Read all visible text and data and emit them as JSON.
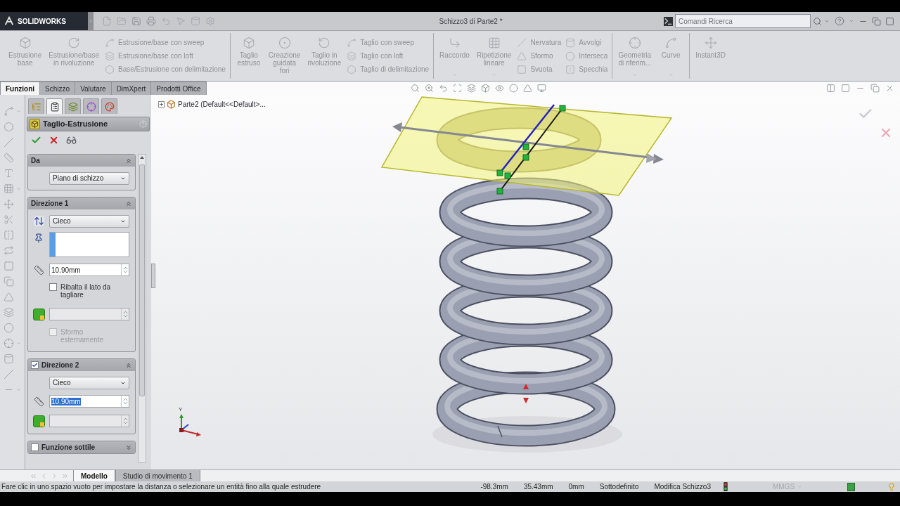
{
  "title_bar": {
    "brand": "SOLIDWORKS",
    "document_title": "Schizzo3 di Parte2 *",
    "search": {
      "placeholder": "Comandi Ricerca"
    }
  },
  "ribbon": {
    "disabled": true,
    "groups": [
      {
        "large": [
          {
            "label": "Estrusione base",
            "menu": false
          },
          {
            "label": "Estrusione/base in rivoluzione",
            "menu": false
          }
        ],
        "columns": [
          [
            "Estrusione/base con sweep",
            "Estrusione/base con loft",
            "Base/Estrusione con delimitazione"
          ]
        ]
      },
      {
        "large": [
          {
            "label": "Taglio estruso",
            "menu": false
          },
          {
            "label": "Creazione guidata fori",
            "menu": false
          },
          {
            "label": "Taglio in rivoluzione",
            "menu": false
          }
        ],
        "columns": [
          [
            "Taglio con sweep",
            "Taglio con loft",
            "Taglio di delimitazione"
          ]
        ]
      },
      {
        "large": [
          {
            "label": "Raccordo",
            "menu": true
          },
          {
            "label": "Ripetizione lineare",
            "menu": true
          }
        ],
        "columns": [
          [
            "Nervatura",
            "Sformo",
            "Svuota"
          ],
          [
            "Avvolgi",
            "Interseca",
            "Specchia"
          ]
        ]
      },
      {
        "large": [
          {
            "label": "Geometria di riferim...",
            "menu": true
          },
          {
            "label": "Curve",
            "menu": true
          }
        ]
      },
      {
        "large": [
          {
            "label": "Instant3D",
            "menu": false
          }
        ]
      }
    ]
  },
  "command_tabs": [
    {
      "label": "Funzioni",
      "selected": true
    },
    {
      "label": "Schizzo",
      "selected": false
    },
    {
      "label": "Valutare",
      "selected": false
    },
    {
      "label": "DimXpert",
      "selected": false
    },
    {
      "label": "Prodotti Office",
      "selected": false
    }
  ],
  "property_manager": {
    "tabs": [
      {
        "selected": false
      },
      {
        "selected": true
      },
      {
        "selected": false
      },
      {
        "selected": false
      },
      {
        "selected": false
      }
    ],
    "title": "Taglio-Estrusione",
    "sections": [
      {
        "title": "Da",
        "kind": "fixed",
        "expanded": true,
        "rows": [
          {
            "kind": "dropdown",
            "value": "Piano di schizzo",
            "reverse_button": false
          }
        ]
      },
      {
        "title": "Direzione 1",
        "kind": "fixed",
        "expanded": true,
        "rows": [
          {
            "kind": "dropdown",
            "value": "Cieco",
            "reverse_button": true
          },
          {
            "kind": "selection",
            "active": true
          },
          {
            "kind": "spinner",
            "value": "10.90mm",
            "selected": false
          },
          {
            "kind": "checkbox",
            "label": "Ribalta il lato da tagliare",
            "checked": false,
            "disabled": false
          },
          {
            "kind": "draft"
          },
          {
            "kind": "checkbox",
            "label": "Sformo esternamente",
            "checked": false,
            "disabled": true
          }
        ]
      },
      {
        "title": "Direzione 2",
        "kind": "optional",
        "checked": true,
        "expanded": true,
        "rows": [
          {
            "kind": "dropdown",
            "value": "Cieco",
            "reverse_button": false
          },
          {
            "kind": "spinner",
            "value": "10.90mm",
            "selected": true
          },
          {
            "kind": "draft"
          }
        ]
      },
      {
        "title": "Funzione sottile",
        "kind": "optional",
        "checked": false,
        "expanded": false
      }
    ]
  },
  "feature_tree": {
    "label": "Parte2 (Default<<Default>...",
    "expanded": false
  },
  "triad": {
    "label": "Y"
  },
  "bottom_tabs": [
    {
      "label": "Modello",
      "selected": true
    },
    {
      "label": "Studio di movimento 1",
      "selected": false
    }
  ],
  "status_bar": {
    "message": "Fare clic in uno spazio vuoto per impostare la distanza o selezionare un entità fino alla quale estrudere",
    "fields": [
      "-98.3mm",
      "35.43mm",
      "0mm",
      "Sottodefinito",
      "Modifica Schizzo3"
    ],
    "units": "MMGS"
  }
}
